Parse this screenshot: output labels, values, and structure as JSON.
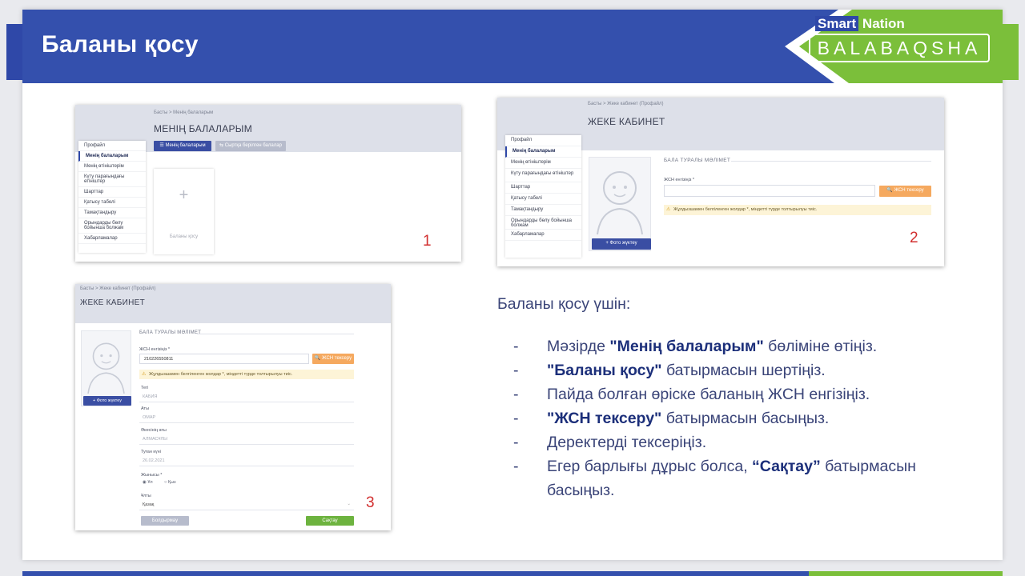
{
  "slide": {
    "title": "Баланы қосу",
    "colors": {
      "header_blue": "#3450ad",
      "accent_green": "#7bbf3a",
      "text_navy": "#3a4478"
    }
  },
  "logo": {
    "top_smart": "Smart",
    "top_nation": "Nation",
    "bottom": "BALABAQSHA"
  },
  "shot1": {
    "breadcrumb": "Басты  >  Менің балаларым",
    "title": "МЕНІҢ БАЛАЛАРЫМ",
    "btn_my_children": "Менің балаларым",
    "btn_archive": "Сыртқа берілген балалар",
    "sidebar": [
      {
        "label": "Профайл"
      },
      {
        "label": "Менің балаларым"
      },
      {
        "label": "Менің өтініштерім"
      },
      {
        "label": "Күту парағындағы өтініштер"
      },
      {
        "label": "Шарттар"
      },
      {
        "label": "Қатысу табелі"
      },
      {
        "label": "Тамақтандыру"
      },
      {
        "label": "Орындарды бөлу бойынша болжам"
      },
      {
        "label": "Хабарламалар"
      }
    ],
    "add_card_label": "Баланы қосу",
    "number": "1"
  },
  "shot2": {
    "breadcrumb": "Басты  >  Жеке кабинет (Профайл)",
    "title": "ЖЕКЕ КАБИНЕТ",
    "sidebar": [
      {
        "label": "Профайл"
      },
      {
        "label": "Менің балаларым"
      },
      {
        "label": "Менің өтініштерім"
      },
      {
        "label": "Күту парағындағы өтініштер"
      },
      {
        "label": "Шарттар"
      },
      {
        "label": "Қатысу табелі"
      },
      {
        "label": "Тамақтандыру"
      },
      {
        "label": "Орындарды бөлу бойынша болжам"
      },
      {
        "label": "Хабарламалар"
      }
    ],
    "section_title": "БАЛА ТУРАЛЫ МӘЛІМЕТ",
    "iin_label": "ЖСН енгізіңіз *",
    "iin_value": "",
    "check_button": "ЖСН тексеру",
    "warning": "Жұлдызшамен белгіленген жолдар *, міндетті түрде толтырылуы тиіс.",
    "photo_button": "Фото жүктеу",
    "number": "2"
  },
  "shot3": {
    "breadcrumb": "Басты  >  Жеке кабинет (Профайл)",
    "title": "ЖЕКЕ КАБИНЕТ",
    "section_title": "БАЛА ТУРАЛЫ МӘЛІМЕТ",
    "iin_label": "ЖСН енгізіңіз *",
    "iin_value": "210226550811",
    "check_button": "ЖСН тексеру",
    "warning": "Жұлдызшамен белгіленген жолдар *, міндетті түрде толтырылуы тиіс.",
    "photo_button": "Фото жүктеу",
    "surname_label": "Тегі",
    "surname_value": "КАБИЯ",
    "name_label": "Аты",
    "name_value": "ОМАР",
    "patronymic_label": "Әкесінің аты",
    "patronymic_value": "АЛМАСҰЛЫ",
    "birth_label": "Туған күні",
    "birth_value": "26.02.2021",
    "gender_label": "Жынысы *",
    "gender_male": "Ұл",
    "gender_female": "Қыз",
    "nationality_label": "Ұлты",
    "nationality_value": "Қазақ",
    "cancel_button": "Болдырмау",
    "save_button": "Сақтау",
    "number": "3"
  },
  "instructions": {
    "intro": "Баланы қосу үшін:",
    "steps": [
      {
        "pre": "Мәзірде ",
        "bold": "\"Менің балаларым\"",
        "post": " бөліміне өтіңіз."
      },
      {
        "pre": "",
        "bold": "\"Баланы қосу\"",
        "post": " батырмасын шертіңіз."
      },
      {
        "pre": "Пайда болған өріске баланың ЖСН енгізіңіз.",
        "bold": "",
        "post": ""
      },
      {
        "pre": "",
        "bold": "\"ЖСН тексеру\"",
        "post": " батырмасын басыңыз."
      },
      {
        "pre": "Деректерді тексеріңіз.",
        "bold": "",
        "post": ""
      },
      {
        "pre": "Егер барлығы дұрыс болса, ",
        "bold": "“Сақтау”",
        "post": " батырмасын басыңыз."
      }
    ]
  }
}
